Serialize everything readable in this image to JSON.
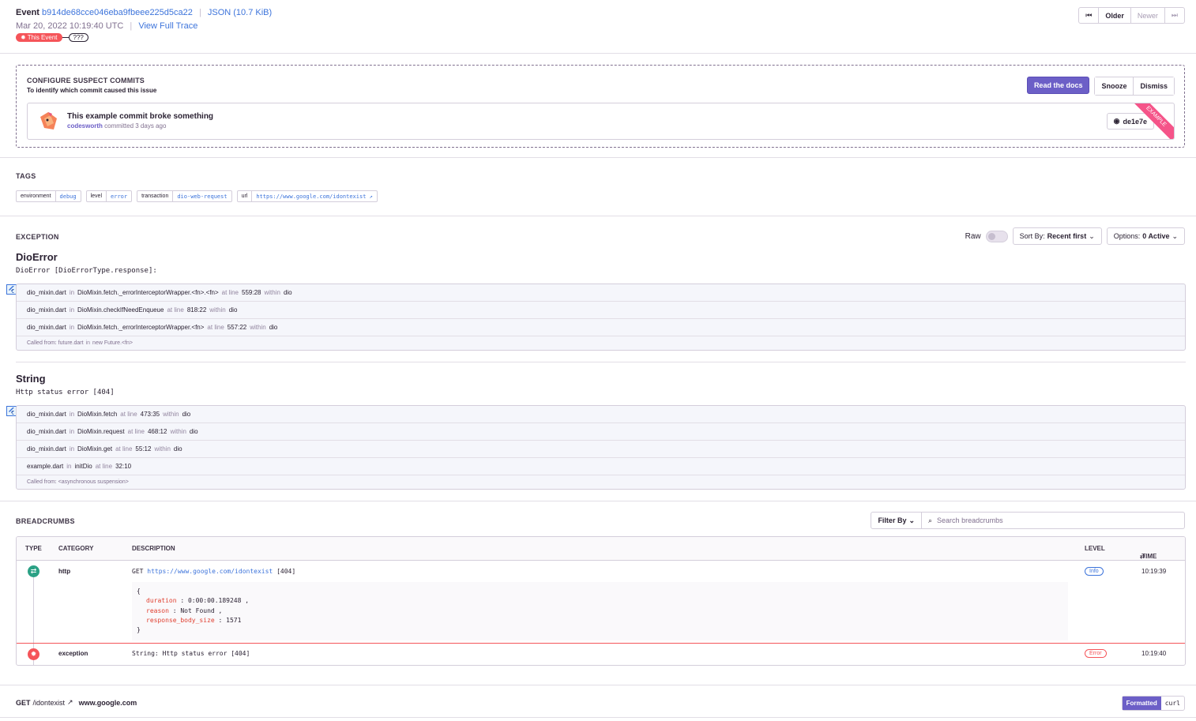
{
  "event": {
    "label": "Event",
    "id": "b914de68cce046eba9fbeee225d5ca22",
    "json_link": "JSON (10.7 KiB)",
    "date": "Mar 20, 2022 10:19:40 UTC",
    "trace_link": "View Full Trace",
    "this_event": "This Event",
    "unknown": "???"
  },
  "pager": {
    "older": "Older",
    "newer": "Newer"
  },
  "suspect": {
    "title": "CONFIGURE SUSPECT COMMITS",
    "subtitle": "To identify which commit caused this issue",
    "read_docs": "Read the docs",
    "snooze": "Snooze",
    "dismiss": "Dismiss",
    "commit_title": "This example commit broke something",
    "author": "codesworth",
    "committed": "committed 3 days ago",
    "sha": "de1e7e",
    "ribbon": "EXAMPLE"
  },
  "tags": {
    "title": "TAGS",
    "items": [
      {
        "key": "environment",
        "value": "debug"
      },
      {
        "key": "level",
        "value": "error"
      },
      {
        "key": "transaction",
        "value": "dio-web-request"
      },
      {
        "key": "url",
        "value": "https://www.google.com/idontexist"
      }
    ]
  },
  "exception": {
    "title": "EXCEPTION",
    "raw": "Raw",
    "sort_label": "Sort By:",
    "sort_value": "Recent first",
    "options_label": "Options:",
    "options_value": "0 Active",
    "errors": [
      {
        "name": "DioError",
        "value": "DioError [DioErrorType.response]:",
        "frames": [
          {
            "file": "dio_mixin.dart",
            "fn": "DioMixin.fetch._errorInterceptorWrapper.<fn>.<fn>",
            "line": "559:28",
            "pkg": "dio"
          },
          {
            "file": "dio_mixin.dart",
            "fn": "DioMixin.checkIfNeedEnqueue",
            "line": "818:22",
            "pkg": "dio"
          },
          {
            "file": "dio_mixin.dart",
            "fn": "DioMixin.fetch._errorInterceptorWrapper.<fn>",
            "line": "557:22",
            "pkg": "dio"
          }
        ],
        "called_file": "Called from: future.dart",
        "called_fn": "new Future.<fn>"
      },
      {
        "name": "String",
        "value": "Http status error [404]",
        "frames": [
          {
            "file": "dio_mixin.dart",
            "fn": "DioMixin.fetch",
            "line": "473:35",
            "pkg": "dio"
          },
          {
            "file": "dio_mixin.dart",
            "fn": "DioMixin.request",
            "line": "468:12",
            "pkg": "dio"
          },
          {
            "file": "dio_mixin.dart",
            "fn": "DioMixin.get",
            "line": "55:12",
            "pkg": "dio"
          },
          {
            "file": "example.dart",
            "fn": "initDio",
            "line": "32:10",
            "pkg": ""
          }
        ],
        "called_file": "Called from: <asynchronous suspension>",
        "called_fn": ""
      }
    ],
    "words": {
      "in": "in",
      "at_line": "at line",
      "within": "within"
    }
  },
  "breadcrumbs": {
    "title": "BREADCRUMBS",
    "filter": "Filter By",
    "search_placeholder": "Search breadcrumbs",
    "columns": {
      "type": "TYPE",
      "category": "CATEGORY",
      "description": "DESCRIPTION",
      "level": "LEVEL",
      "time": "TIME"
    },
    "rows": [
      {
        "category": "http",
        "method": "GET",
        "url": "https://www.google.com/idontexist",
        "status": "[404]",
        "level": "Info",
        "time": "10:19:39",
        "data": [
          {
            "key": "duration",
            "value": "0:00:00.189248"
          },
          {
            "key": "reason",
            "value": "Not Found"
          },
          {
            "key": "response_body_size",
            "value": "1571"
          }
        ]
      },
      {
        "category": "exception",
        "description": "String: Http status error [404]",
        "level": "Error",
        "time": "10:19:40"
      }
    ]
  },
  "request": {
    "method": "GET",
    "path": "/idontexist",
    "host": "www.google.com",
    "formatted": "Formatted",
    "curl": "curl"
  }
}
